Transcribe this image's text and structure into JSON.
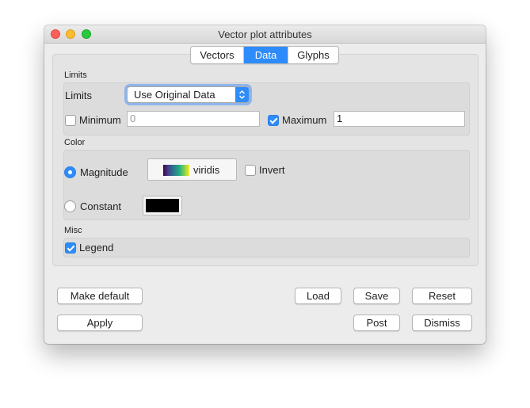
{
  "window": {
    "title": "Vector plot attributes"
  },
  "tabs": [
    {
      "label": "Vectors",
      "active": false
    },
    {
      "label": "Data",
      "active": true
    },
    {
      "label": "Glyphs",
      "active": false
    }
  ],
  "limits": {
    "section_title": "Limits",
    "mode_label": "Limits",
    "mode_value": "Use Original Data",
    "minimum": {
      "label": "Minimum",
      "checked": false,
      "value": "0"
    },
    "maximum": {
      "label": "Maximum",
      "checked": true,
      "value": "1"
    }
  },
  "color": {
    "section_title": "Color",
    "magnitude": {
      "label": "Magnitude",
      "selected": true
    },
    "colormap": {
      "name": "viridis",
      "swatch": [
        "#440154",
        "#414487",
        "#2a788e",
        "#22a884",
        "#7ad151",
        "#fde725"
      ]
    },
    "invert": {
      "label": "Invert",
      "checked": false
    },
    "constant": {
      "label": "Constant",
      "selected": false,
      "color": "#000000"
    }
  },
  "misc": {
    "section_title": "Misc",
    "legend": {
      "label": "Legend",
      "checked": true
    }
  },
  "buttons": {
    "make_default": "Make default",
    "load": "Load",
    "save": "Save",
    "reset": "Reset",
    "apply": "Apply",
    "post": "Post",
    "dismiss": "Dismiss"
  },
  "theme": {
    "accent": "#2d8cf9"
  }
}
